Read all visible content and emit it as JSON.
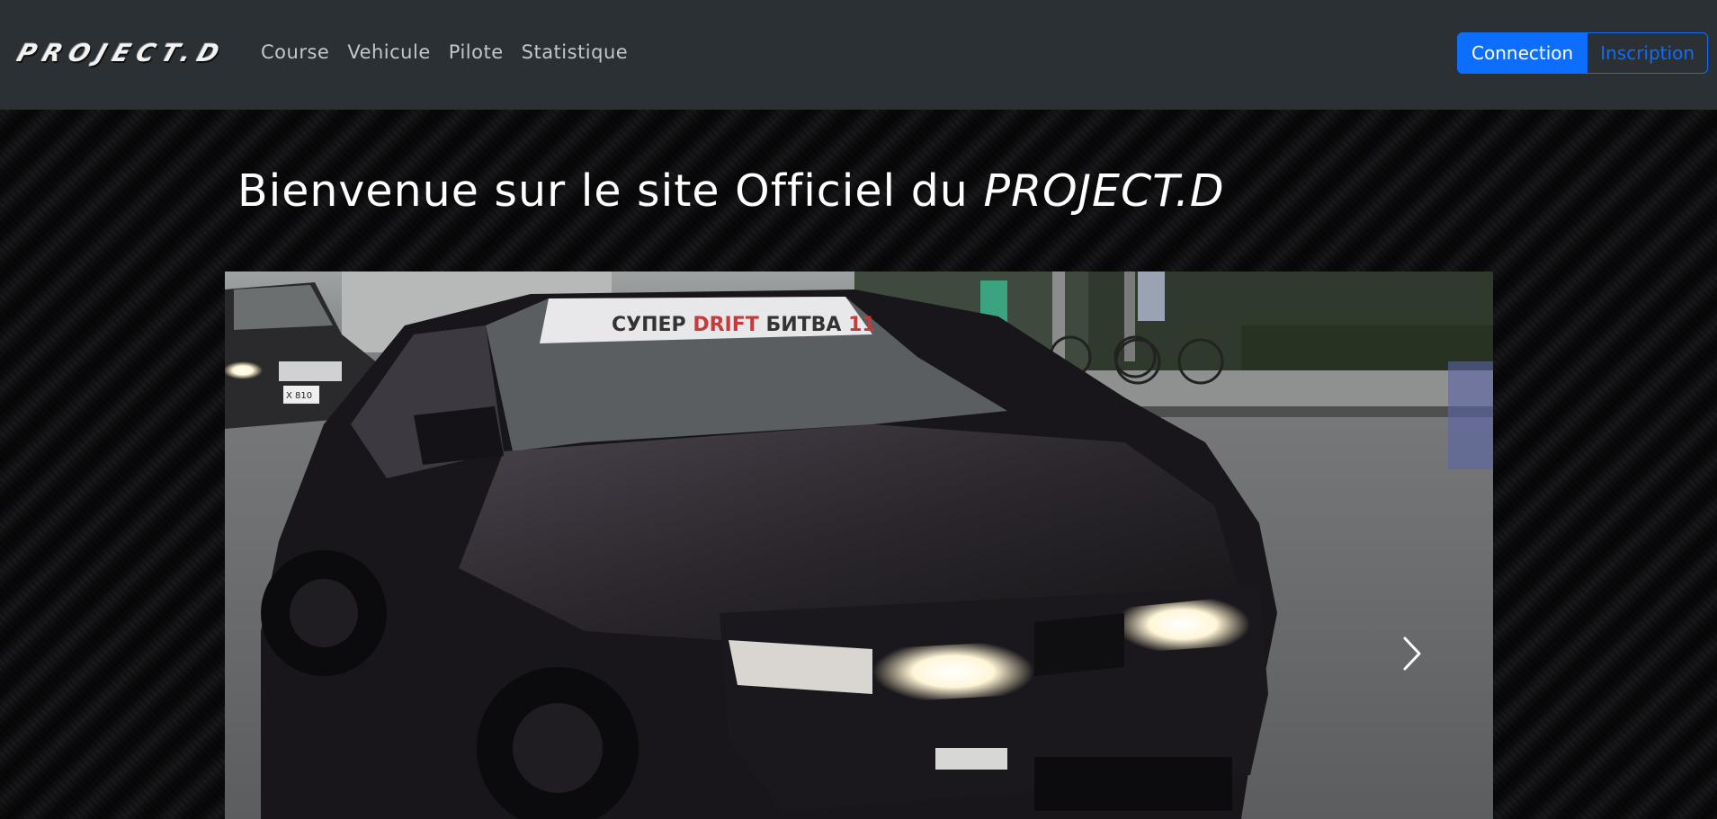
{
  "brand": "PROJECT.D",
  "nav": {
    "links": [
      "Course",
      "Vehicule",
      "Pilote",
      "Statistique"
    ]
  },
  "auth": {
    "connect_label": "Connection",
    "signup_label": "Inscription"
  },
  "hero": {
    "title_prefix": "Bienvenue sur le site Officiel du ",
    "title_brand": "PROJECT.D"
  },
  "carousel": {
    "windshield_text_1": "СУПЕР ",
    "windshield_text_2": "DRIFT",
    "windshield_text_3": " БИТВА ",
    "windshield_text_4": "11",
    "plate_text": "Х 810",
    "next_icon": "chevron-right-icon"
  },
  "colors": {
    "navbar_bg": "#2b3035",
    "primary": "#0d6efd",
    "nav_text": "#c4c6c8"
  }
}
